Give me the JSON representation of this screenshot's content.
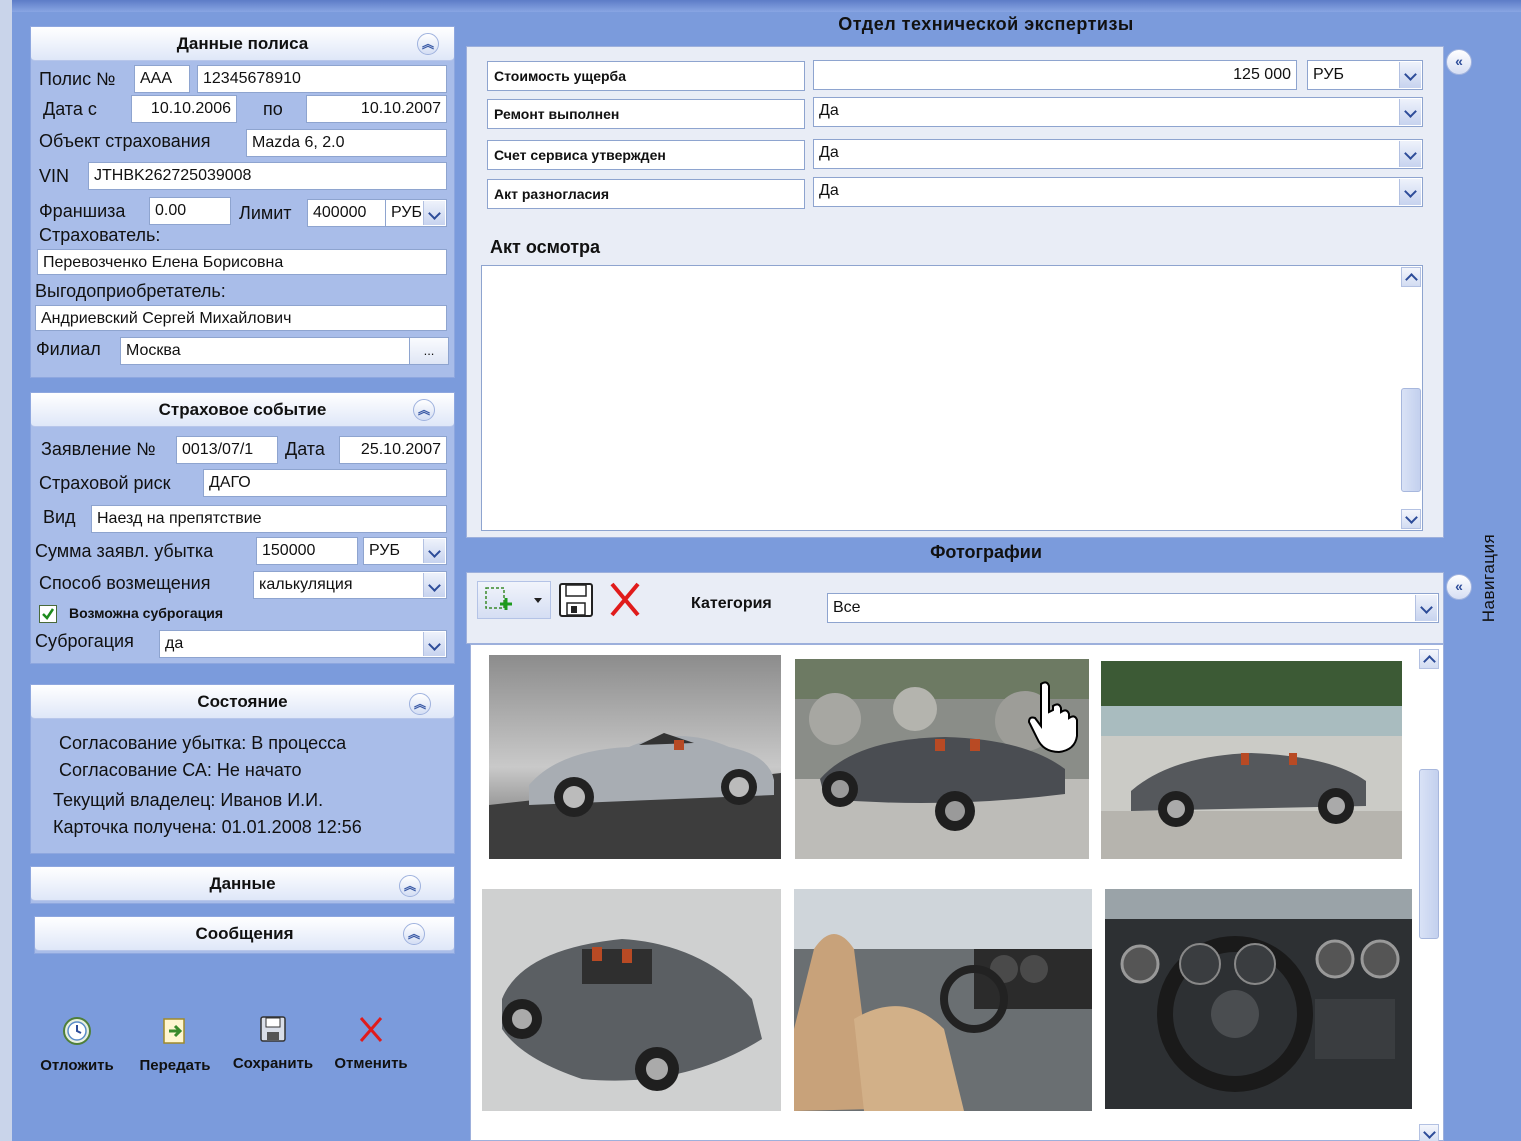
{
  "policy": {
    "title": "Данные полиса",
    "policy_no_label": "Полис №",
    "policy_series": "AAA",
    "policy_number": "12345678910",
    "date_from_label": "Дата с",
    "date_from": "10.10.2006",
    "date_to_label": "по",
    "date_to": "10.10.2007",
    "object_label": "Объект страхования",
    "object": "Mazda 6, 2.0",
    "vin_label": "VIN",
    "vin": "JTHBK262725039008",
    "franchise_label": "Франшиза",
    "franchise": "0.00",
    "limit_label": "Лимит",
    "limit": "400000",
    "limit_currency": "РУБ",
    "insurer_label": "Страхователь:",
    "insurer": "Перевозченко Елена Борисовна",
    "beneficiary_label": "Выгодоприобретатель:",
    "beneficiary": "Андриевский Сергей Михайлович",
    "branch_label": "Филиал",
    "branch": "Москва",
    "branch_button": "..."
  },
  "event": {
    "title": "Страховое событие",
    "claim_no_label": "Заявление №",
    "claim_no": "0013/07/1",
    "date_label": "Дата",
    "date": "25.10.2007",
    "risk_label": "Страховой риск",
    "risk": "ДАГО",
    "kind_label": "Вид",
    "kind": "Наезд на препятствие",
    "amount_label": "Сумма заявл. убытка",
    "amount": "150000",
    "amount_currency": "РУБ",
    "compensation_label": "Способ возмещения",
    "compensation": "калькуляция",
    "subrogation_possible_label": "Возможна суброгация",
    "subrogation_possible": true,
    "subrogation_label": "Суброгация",
    "subrogation": "да"
  },
  "state": {
    "title": "Состояние",
    "lines": [
      "Согласование убытка: В процесса",
      "Согласование СА: Не начато",
      "Текущий владелец: Иванов И.И.",
      "Карточка получена: 01.01.2008 12:56"
    ]
  },
  "data_section": {
    "title": "Данные"
  },
  "messages_section": {
    "title": "Сообщения"
  },
  "actions": {
    "postpone": "Отложить",
    "transfer": "Передать",
    "save": "Сохранить",
    "cancel": "Отменить"
  },
  "expertise": {
    "title": "Отдел технической экспертизы",
    "damage_cost_label": "Стоимость ущерба",
    "damage_cost": "125 000",
    "damage_currency": "РУБ",
    "repair_done_label": "Ремонт выполнен",
    "repair_done": "Да",
    "invoice_approved_label": "Счет сервиса утвержден",
    "invoice_approved": "Да",
    "disagreement_label": "Акт разногласия",
    "disagreement": "Да",
    "inspection_label": "Акт осмотра",
    "inspection_text": ""
  },
  "photos": {
    "title": "Фотографии",
    "category_label": "Категория",
    "category": "Все",
    "nav_label": "Навигация"
  },
  "colors": {
    "background": "#7b9bdc",
    "section": "#a9bde9",
    "panel": "#e9edf6",
    "cancel_red": "#e01b1b"
  }
}
